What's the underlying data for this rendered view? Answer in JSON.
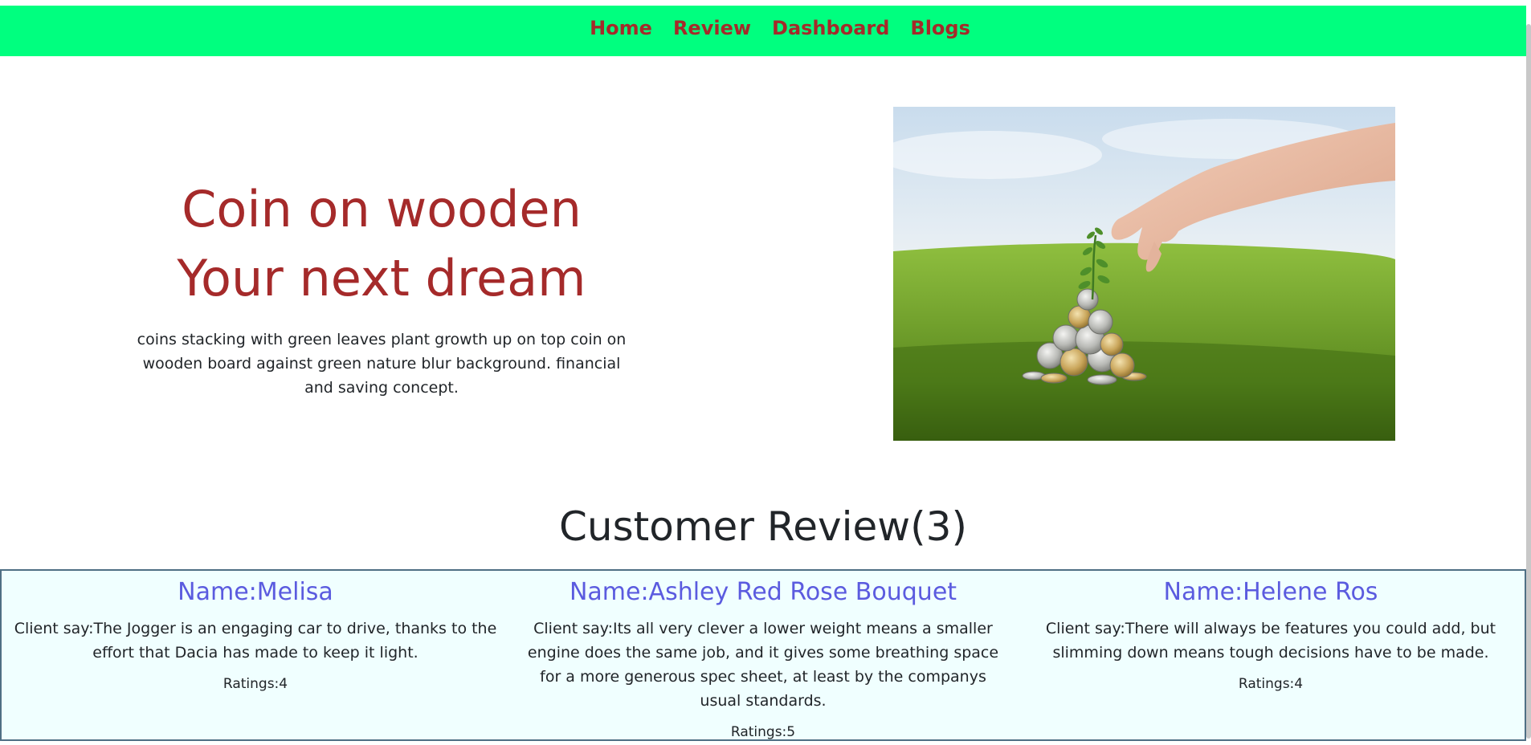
{
  "nav": {
    "items": [
      {
        "label": "Home"
      },
      {
        "label": "Review"
      },
      {
        "label": "Dashboard"
      },
      {
        "label": "Blogs"
      }
    ]
  },
  "hero": {
    "title_line1": "Coin on wooden",
    "title_line2": "Your next dream",
    "description": "coins stacking with green leaves plant growth up on top coin on wooden board against green nature blur background. financial and saving concept."
  },
  "reviews": {
    "heading": "Customer Review(3)",
    "items": [
      {
        "name": "Name:Melisa",
        "text": "Client say:The Jogger is an engaging car to drive, thanks to the effort that Dacia has made to keep it light.",
        "rating": "Ratings:4"
      },
      {
        "name": "Name:Ashley Red Rose Bouquet",
        "text": "Client say:Its all very clever a lower weight means a smaller engine does the same job, and it gives some breathing space for a more generous spec sheet, at least by the companys usual standards.",
        "rating": "Ratings:5"
      },
      {
        "name": "Name:Helene Ros",
        "text": "Client say:There will always be features you could add, but slimming down means tough decisions have to be made.",
        "rating": "Ratings:4"
      }
    ]
  },
  "colors": {
    "nav_bg": "#00ff7f",
    "brand_text": "#a52a2a",
    "review_name": "#5b5bdf",
    "review_bg": "#f0ffff"
  }
}
